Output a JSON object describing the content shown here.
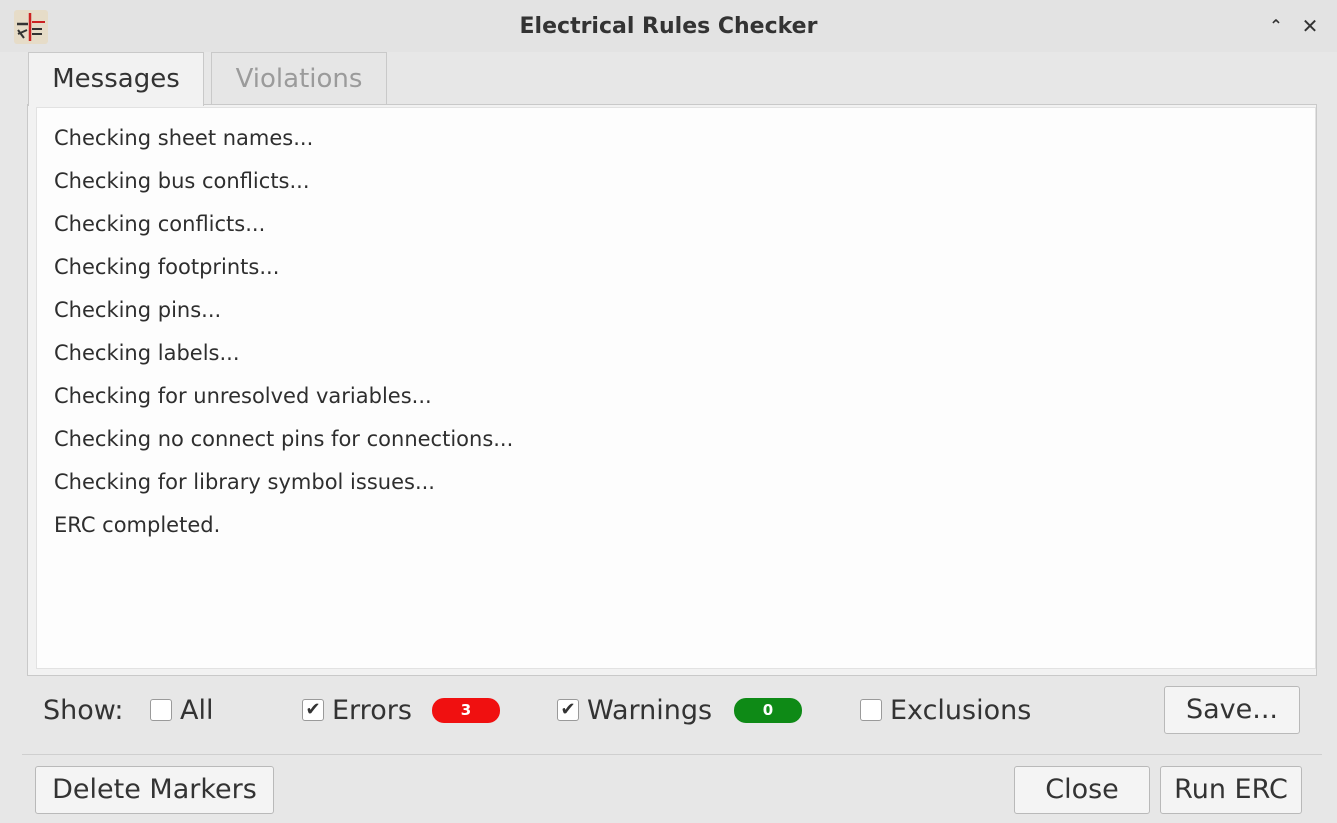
{
  "window": {
    "title": "Electrical Rules Checker"
  },
  "tabs": [
    "Messages",
    "Violations"
  ],
  "messages": [
    "Checking sheet names...",
    "Checking bus conflicts...",
    "Checking conflicts...",
    "Checking footprints...",
    "Checking pins...",
    "Checking labels...",
    "Checking for unresolved variables...",
    "Checking no connect pins for connections...",
    "Checking for library symbol issues...",
    "ERC completed."
  ],
  "filters": {
    "show_label": "Show:",
    "all": {
      "label": "All",
      "checked": false
    },
    "errors": {
      "label": "Errors",
      "checked": true,
      "count": "3",
      "badge_color": "#f01010"
    },
    "warnings": {
      "label": "Warnings",
      "checked": true,
      "count": "0",
      "badge_color": "#0e8a16"
    },
    "exclusions": {
      "label": "Exclusions",
      "checked": false
    }
  },
  "buttons": {
    "save": "Save...",
    "delete_markers": "Delete Markers",
    "close": "Close",
    "run_erc": "Run ERC"
  }
}
